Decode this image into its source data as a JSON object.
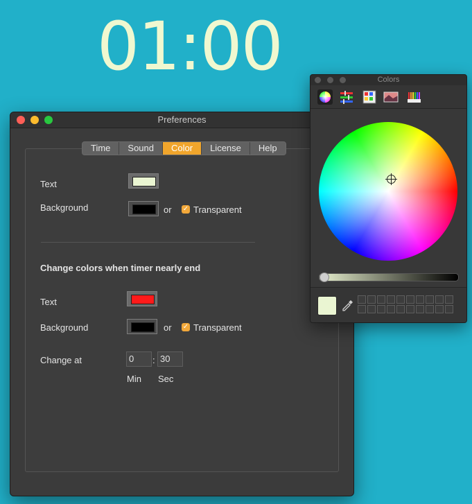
{
  "timer": {
    "display": "01:00",
    "color": "#f0f8d0"
  },
  "preferences": {
    "title": "Preferences",
    "tabs": [
      {
        "label": "Time"
      },
      {
        "label": "Sound"
      },
      {
        "label": "Color",
        "active": true
      },
      {
        "label": "License"
      },
      {
        "label": "Help"
      }
    ],
    "normal": {
      "text_label": "Text",
      "text_color": "#eaf5d2",
      "background_label": "Background",
      "background_color": "#000000",
      "or": "or",
      "transparent_label": "Transparent",
      "transparent_checked": true
    },
    "section_title": "Change colors when timer nearly end",
    "nearly_end": {
      "text_label": "Text",
      "text_color": "#ff1a1a",
      "background_label": "Background",
      "background_color": "#000000",
      "or": "or",
      "transparent_label": "Transparent",
      "transparent_checked": true,
      "change_at_label": "Change at",
      "min_value": "0",
      "sec_value": "30",
      "separator": ":",
      "min_label": "Min",
      "sec_label": "Sec"
    }
  },
  "colors_panel": {
    "title": "Colors",
    "toolbar": [
      "color-wheel-icon",
      "color-sliders-icon",
      "color-palettes-icon",
      "image-palettes-icon",
      "pencils-icon"
    ],
    "selected_tool": "color-wheel-icon",
    "current_color": "#eaf5d2",
    "brightness": 1.0
  }
}
